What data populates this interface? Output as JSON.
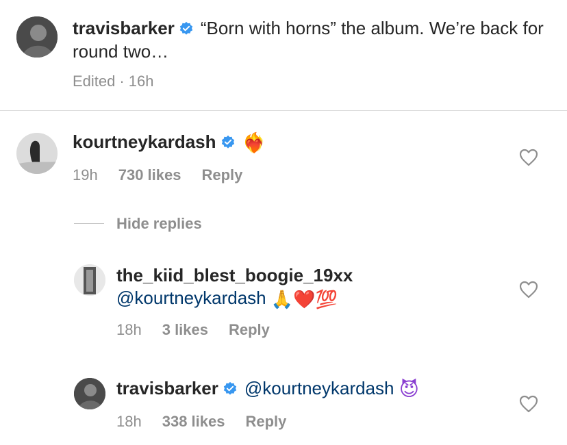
{
  "caption": {
    "username": "travisbarker",
    "text": "“Born with horns” the album. We’re back for round two…",
    "edited": "Edited",
    "separator": "·",
    "time": "16h"
  },
  "comments": [
    {
      "username": "kourtneykardash",
      "text": "",
      "emoji": "❤️‍🔥",
      "time": "19h",
      "likes": "730 likes",
      "reply": "Reply"
    }
  ],
  "hide_replies": "Hide replies",
  "replies": [
    {
      "username": "the_kiid_blest_boogie_19xx",
      "mention": "@kourtneykardash",
      "emojis": "🙏❤️💯",
      "time": "18h",
      "likes": "3 likes",
      "reply": "Reply"
    },
    {
      "username": "travisbarker",
      "mention": "@kourtneykardash",
      "emojis": "😈",
      "time": "18h",
      "likes": "338 likes",
      "reply": "Reply"
    }
  ],
  "colors": {
    "verified": "#3897f0",
    "mention": "#00376b",
    "secondary_text": "#8e8e8e"
  },
  "icons": [
    "verified-badge-icon",
    "heart-outline-icon"
  ]
}
